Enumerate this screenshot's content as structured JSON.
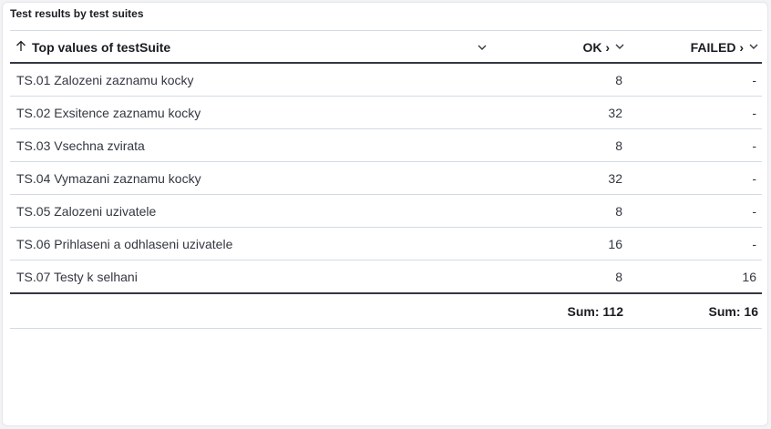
{
  "panel": {
    "title": "Test results by test suites"
  },
  "table": {
    "columns": {
      "suite": "Top values of testSuite",
      "ok": "OK ›",
      "failed": "FAILED ›"
    },
    "rows": [
      {
        "suite": "TS.01 Zalozeni zaznamu kocky",
        "ok": "8",
        "failed": "-"
      },
      {
        "suite": "TS.02 Exsitence zaznamu kocky",
        "ok": "32",
        "failed": "-"
      },
      {
        "suite": "TS.03 Vsechna zvirata",
        "ok": "8",
        "failed": "-"
      },
      {
        "suite": "TS.04 Vymazani zaznamu kocky",
        "ok": "32",
        "failed": "-"
      },
      {
        "suite": "TS.05 Zalozeni uzivatele",
        "ok": "8",
        "failed": "-"
      },
      {
        "suite": "TS.06 Prihlaseni a odhlaseni uzivatele",
        "ok": "16",
        "failed": "-"
      },
      {
        "suite": "TS.07 Testy k selhani",
        "ok": "8",
        "failed": "16"
      }
    ],
    "footer": {
      "ok": "Sum: 112",
      "failed": "Sum: 16"
    }
  },
  "icons": {
    "sort": "sort-ascending-icon",
    "chevron": "chevron-down-icon"
  }
}
